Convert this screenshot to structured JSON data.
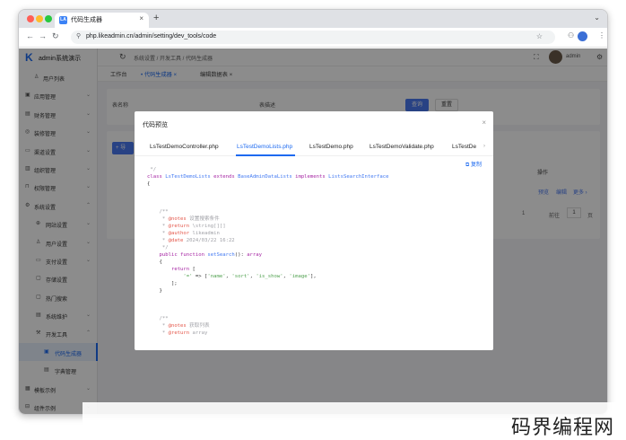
{
  "browser": {
    "tab_title": "代码生成器",
    "tab_close": "×",
    "new_tab": "+",
    "url": "php.likeadmin.cn/admin/setting/dev_tools/code",
    "favicon": "LA"
  },
  "app": {
    "logo_text": "admin系统演示",
    "user_name": "admin"
  },
  "sidebar": {
    "items": [
      {
        "label": "用户列表",
        "icon": "user-icon"
      },
      {
        "label": "应用管理",
        "icon": "app-icon"
      },
      {
        "label": "财务管理",
        "icon": "finance-icon"
      },
      {
        "label": "装修管理",
        "icon": "decorate-icon"
      },
      {
        "label": "渠道设置",
        "icon": "channel-icon"
      },
      {
        "label": "组织管理",
        "icon": "org-icon"
      },
      {
        "label": "权限管理",
        "icon": "lock-icon"
      },
      {
        "label": "系统设置",
        "icon": "gear-icon"
      },
      {
        "label": "网站设置",
        "icon": "site-icon"
      },
      {
        "label": "用户设置",
        "icon": "user-setting-icon"
      },
      {
        "label": "支付设置",
        "icon": "pay-icon"
      },
      {
        "label": "存储设置",
        "icon": "storage-icon"
      },
      {
        "label": "热门搜索",
        "icon": "hot-search-icon"
      },
      {
        "label": "系统维护",
        "icon": "maintenance-icon"
      },
      {
        "label": "开发工具",
        "icon": "dev-tools-icon"
      },
      {
        "label": "代码生成器",
        "icon": "code-icon"
      },
      {
        "label": "字典管理",
        "icon": "dict-icon"
      },
      {
        "label": "模板示例",
        "icon": "template-icon"
      },
      {
        "label": "组件示例",
        "icon": "component-icon"
      }
    ]
  },
  "topbar": {
    "breadcrumb": "系统设置  /  开发工具  /  代码生成器"
  },
  "page_tabs": [
    {
      "label": "工作台"
    },
    {
      "label": "• 代码生成器  ×"
    },
    {
      "label": "编辑数据表  ×"
    }
  ],
  "search": {
    "label1": "表名称",
    "label2": "表描述",
    "query_button": "查询",
    "reset_button": "重置"
  },
  "list": {
    "add_button": "+ 导",
    "col_action": "操作",
    "row_actions": [
      "预览",
      "编辑",
      "更多 ›"
    ],
    "pager_prefix": "1",
    "pager_goto": "前往",
    "pager_page": "1",
    "pager_suffix": "页"
  },
  "dialog": {
    "title": "代码预览",
    "close": "×",
    "copy": "复制",
    "tabs": [
      "LsTestDemoController.php",
      "LsTestDemoLists.php",
      "LsTestDemo.php",
      "LsTestDemoValidate.php",
      "LsTestDe"
    ],
    "more": "›"
  },
  "code_lines": [
    " */",
    "class LsTestDemoLists extends BaseAdminDataLists implements ListsSearchInterface",
    "{",
    "",
    "",
    "    /**",
    "     * @notes 设置搜索条件",
    "     * @return \\string[][]",
    "     * @author likeadmin",
    "     * @date 2024/03/22 16:22",
    "     */",
    "    public function setSearch(): array",
    "    {",
    "        return [",
    "            '=' => ['name', 'sort', 'is_show', 'image'],",
    "        ];",
    "    }",
    "",
    "",
    "    /**",
    "     * @notes 获取列表",
    "     * @return array"
  ],
  "watermark": "码界编程网",
  "colors": {
    "accent": "#1d6af0",
    "primary_button": "#4a78f0"
  }
}
